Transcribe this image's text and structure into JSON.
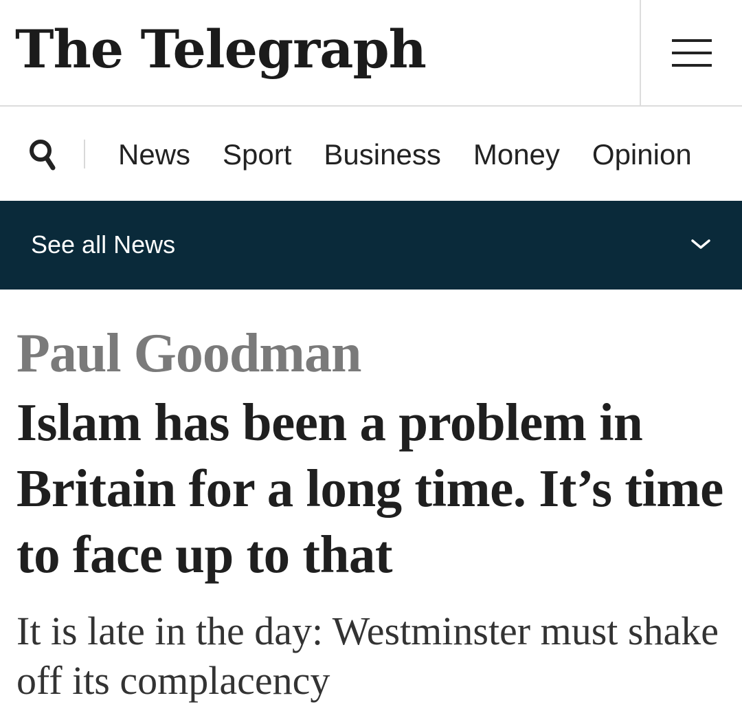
{
  "masthead": {
    "logo_text": "The Telegraph",
    "menu_icon": "hamburger-menu-icon"
  },
  "nav": {
    "search_icon": "search-icon",
    "items": [
      {
        "label": "News"
      },
      {
        "label": "Sport"
      },
      {
        "label": "Business"
      },
      {
        "label": "Money"
      },
      {
        "label": "Opinion"
      }
    ]
  },
  "see_all": {
    "label": "See all News",
    "icon": "chevron-down-icon",
    "background": "#0a2a3a"
  },
  "article": {
    "author": "Paul Goodman",
    "headline": "Islam has been a problem in Britain for a long time. It’s time to face up to that",
    "standfirst": "It is late in the day: Westminster must shake off its complacency"
  },
  "colors": {
    "brand_dark": "#0a2a3a",
    "author_gray": "#7a7a7a",
    "text": "#222222"
  }
}
